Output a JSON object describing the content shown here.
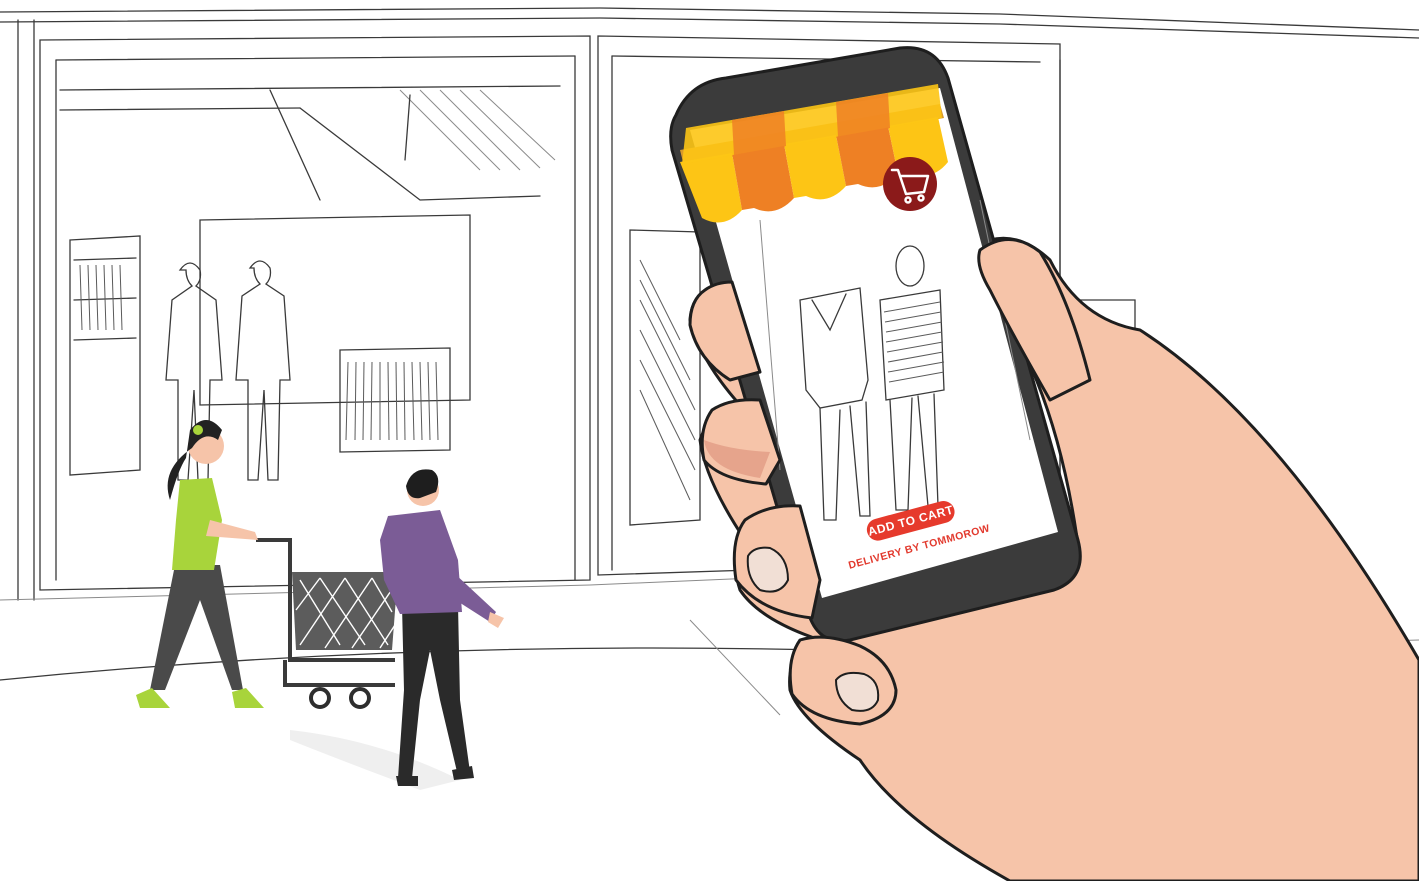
{
  "phone_screen": {
    "add_to_cart_label": "ADD TO CART",
    "delivery_label": "DELIVERY BY TOMMOROW",
    "cart_icon": "shopping-cart-icon"
  },
  "colors": {
    "awning_yellow": "#fdc515",
    "awning_orange": "#ee8024",
    "cart_badge": "#8b1a1a",
    "add_to_cart_button": "#e63a2c",
    "delivery_text": "#e23a2e",
    "phone_body": "#3b3b3b",
    "skin": "#f6c4a9",
    "woman_top": "#a8d43b",
    "man_top": "#7b5c96"
  }
}
